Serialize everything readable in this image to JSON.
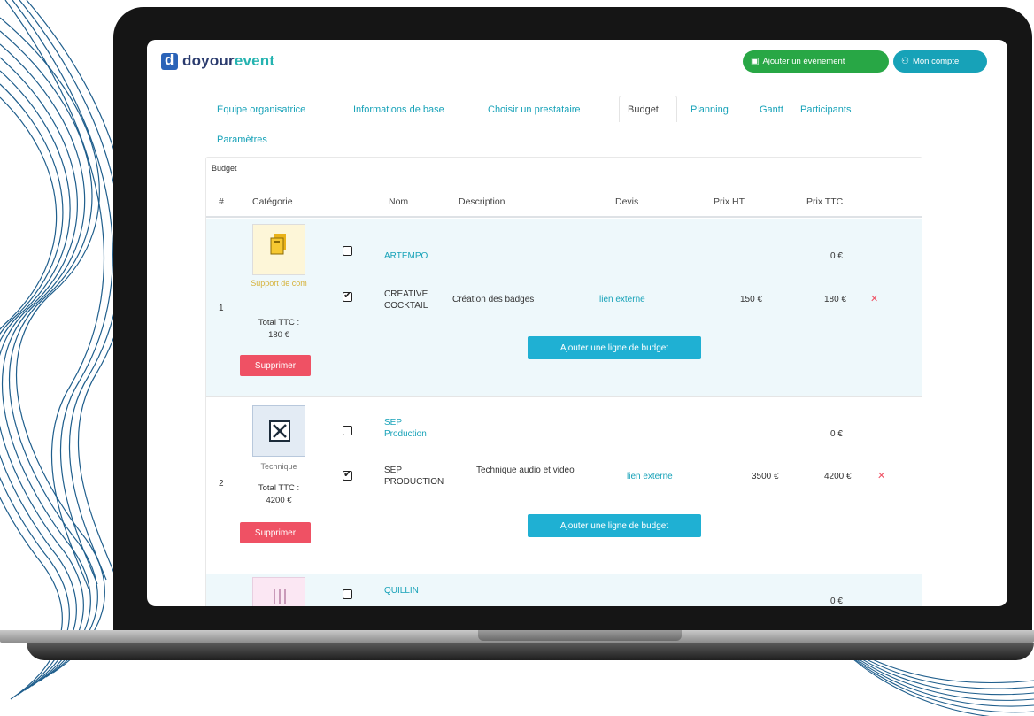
{
  "app": {
    "logo_prefix": "do",
    "logo_mid": "your",
    "logo_accent": "event"
  },
  "header": {
    "add_event_label": "Ajouter un événement",
    "account_label": "Mon compte"
  },
  "tabs": [
    {
      "label": "Équipe organisatrice"
    },
    {
      "label": "Informations de base"
    },
    {
      "label": "Choisir un prestataire"
    },
    {
      "label": "Budget"
    },
    {
      "label": "Planning"
    },
    {
      "label": "Gantt"
    },
    {
      "label": "Participants"
    },
    {
      "label": "Paramètres"
    }
  ],
  "budget": {
    "title": "Budget",
    "columns": [
      "#",
      "Catégorie",
      "Nom",
      "Description",
      "Devis",
      "Prix HT",
      "Prix TTC"
    ],
    "rows": [
      {
        "index": "1",
        "category": "Support de com",
        "total_label": "Total TTC :",
        "total_value": "180 €",
        "delete_label": "Supprimer",
        "add_line_label": "Ajouter une ligne de budget",
        "lines": [
          {
            "checked": false,
            "name": "ARTEMPO",
            "description": "",
            "quote": "",
            "price_ht": "",
            "price_ttc": "0 €"
          },
          {
            "checked": true,
            "name": "CREATIVE COCKTAIL",
            "description": "Création des badges",
            "quote": "lien externe",
            "price_ht": "150 €",
            "price_ttc": "180 €"
          }
        ]
      },
      {
        "index": "2",
        "category": "Technique",
        "total_label": "Total TTC :",
        "total_value": "4200 €",
        "delete_label": "Supprimer",
        "add_line_label": "Ajouter une ligne de budget",
        "lines": [
          {
            "checked": false,
            "name": "SEP Production",
            "description": "",
            "quote": "",
            "price_ht": "",
            "price_ttc": "0 €"
          },
          {
            "checked": true,
            "name": "SEP PRODUCTION",
            "description": "Technique audio et video",
            "quote": "lien externe",
            "price_ht": "3500 €",
            "price_ttc": "4200 €"
          }
        ]
      },
      {
        "index": "",
        "lines": [
          {
            "checked": false,
            "name": "QUILLIN",
            "price_ttc": "0 €"
          }
        ]
      }
    ]
  },
  "icons": {
    "add_event": "calendar-icon",
    "account": "user-icon",
    "delete_line": "close-icon"
  },
  "colors": {
    "primary": "#17a2b8",
    "success": "#28a745",
    "danger": "#ef5164",
    "row_highlight": "#eef8fb"
  }
}
